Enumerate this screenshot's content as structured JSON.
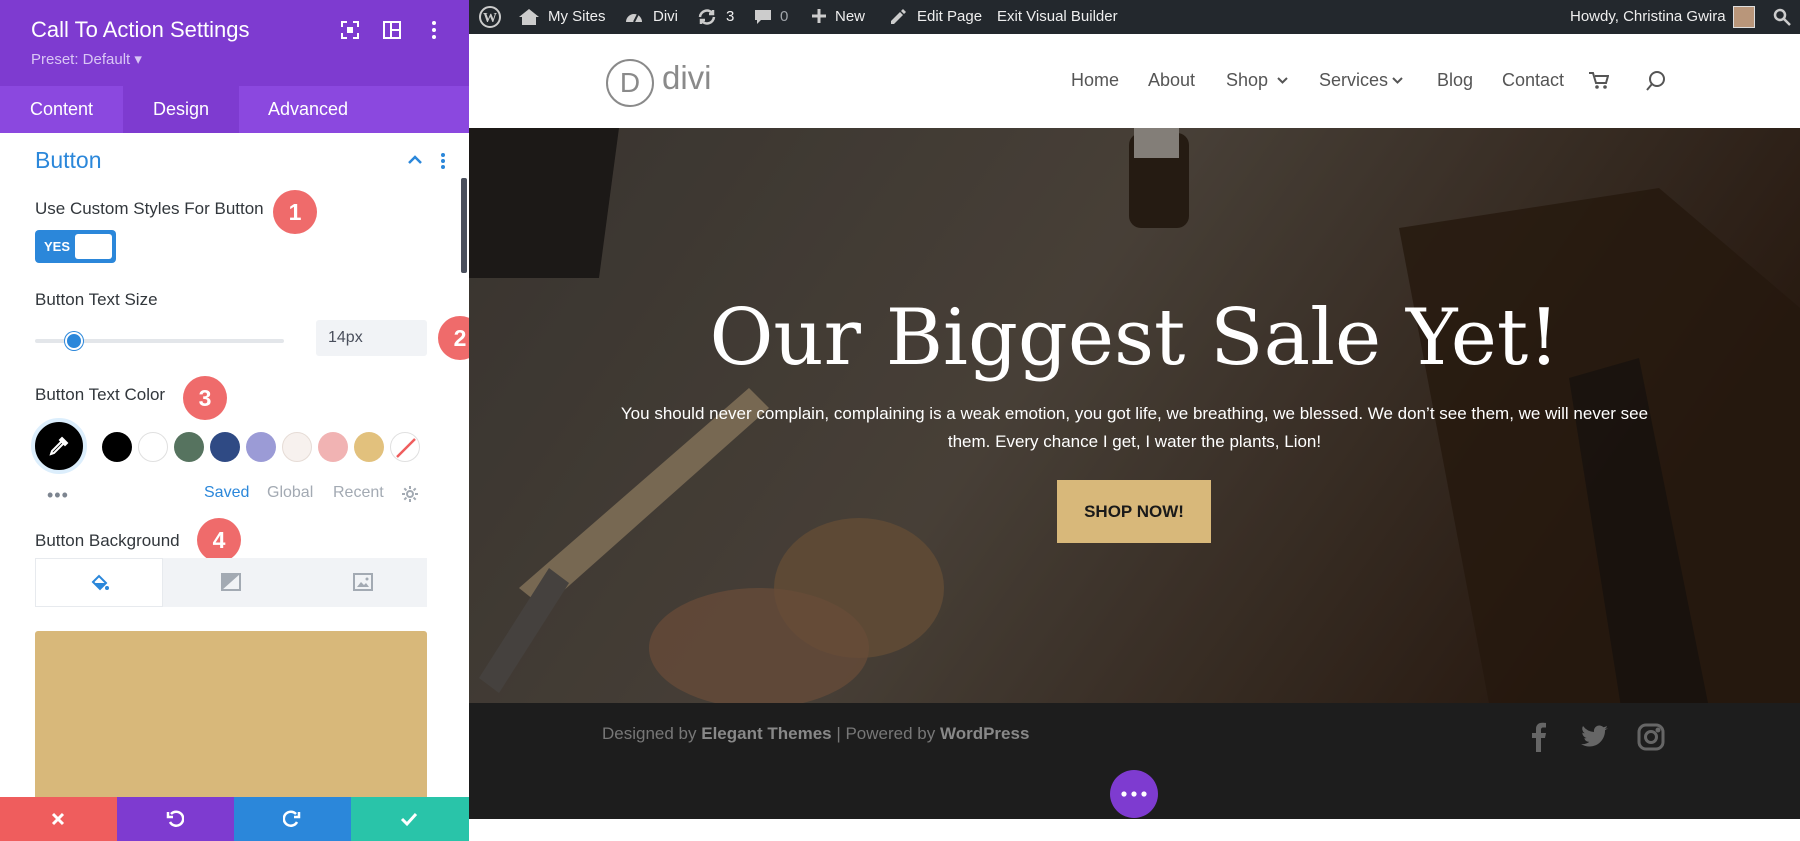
{
  "panel": {
    "title": "Call To Action Settings",
    "preset": "Preset: Default ▾",
    "tabs": [
      "Content",
      "Design",
      "Advanced"
    ],
    "active_tab": "Design",
    "section_title": "Button",
    "custom_styles": {
      "label": "Use Custom Styles For Button",
      "toggle_text": "YES",
      "value": true
    },
    "text_size": {
      "label": "Button Text Size",
      "value": "14px",
      "slider_fraction": 0.14
    },
    "text_color": {
      "label": "Button Text Color",
      "selected": "#000000",
      "swatches": [
        "#000000",
        "#ffffff",
        "#56735f",
        "#2f4a84",
        "#9b9bd6",
        "#f7f1ee",
        "#f1b3b3",
        "#e2c17d"
      ]
    },
    "color_tabs": [
      "Saved",
      "Global",
      "Recent"
    ],
    "active_color_tab": "Saved",
    "more": "•••",
    "background": {
      "label": "Button Background",
      "tabs": [
        "color",
        "gradient",
        "image"
      ],
      "color": "#d8b87a"
    },
    "steps": [
      "1",
      "2",
      "3",
      "4"
    ],
    "footer_colors": {
      "cancel": "#ef5d5d",
      "undo": "#7e3bd0",
      "redo": "#2b87da",
      "save": "#29c4a9"
    }
  },
  "adminbar": {
    "my_sites": "My Sites",
    "divi": "Divi",
    "updates": "3",
    "comments": "0",
    "new": "New",
    "edit_page": "Edit Page",
    "exit_vb": "Exit Visual Builder",
    "howdy": "Howdy, Christina Gwira"
  },
  "site": {
    "logo_letter": "D",
    "logo_text": "divi",
    "nav": [
      "Home",
      "About",
      "Shop",
      "Services",
      "Blog",
      "Contact"
    ],
    "hero": {
      "title": "Our Biggest Sale Yet!",
      "subtitle": "You should never complain, complaining is a weak emotion, you got life, we breathing, we blessed. We don’t see them, we will never see them. Every chance I get, I water the plants, Lion!",
      "button": "SHOP NOW!"
    },
    "footer": {
      "designed_by": "Designed by ",
      "elegant": "Elegant Themes",
      "powered": " | Powered by ",
      "wordpress": "WordPress"
    }
  },
  "colors": {
    "divi_purple": "#7e3bd0",
    "divi_blue": "#2b87da",
    "step_red": "#ef6b6b",
    "button_gold": "#d8b87a"
  }
}
